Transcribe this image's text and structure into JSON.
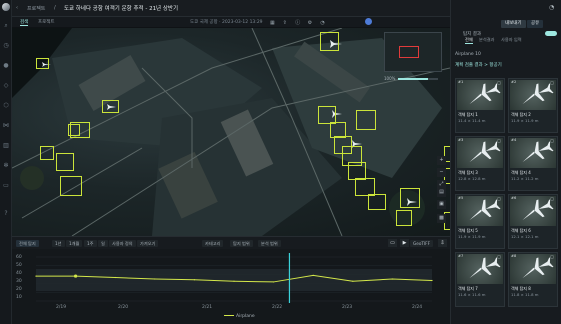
{
  "header": {
    "breadcrumb": [
      "프로젝트",
      "/"
    ],
    "title": "도쿄 하네다 공항 여객기 운항 추적 - 21년 상반기",
    "tabs": [
      "검색",
      "프로젝트"
    ],
    "active_tab": "검색",
    "meta": "도쿄 국제 공항 · 2023-03-12 13:29"
  },
  "map": {
    "opacity_label": "100%",
    "opacity_value": 0.75,
    "controls": [
      "plus-icon",
      "minus-icon",
      "expand-icon",
      "layers-icon",
      "camera-icon"
    ]
  },
  "timeline": {
    "chips": [
      "전체 탐지",
      "1년",
      "1개월",
      "1주",
      "일",
      "사용자 정의",
      "가져오기"
    ],
    "filters": [
      "카테고리",
      "탐지 범위",
      "분석 범위"
    ],
    "export": "GeoTIFF",
    "y_ticks": [
      "60",
      "50",
      "40",
      "30",
      "20",
      "10"
    ],
    "x_ticks": [
      "2/19",
      "2/20",
      "2/21",
      "2/22",
      "2/23",
      "2/24"
    ],
    "legend": "Airplane"
  },
  "chart_data": {
    "type": "line",
    "x": [
      "2/19",
      "2/19.5",
      "2/20",
      "2/20.5",
      "2/21",
      "2/21.5",
      "2/22",
      "2/22.5",
      "2/23",
      "2/23.5",
      "2/24"
    ],
    "series": [
      {
        "name": "Airplane",
        "values": [
          34,
          34,
          32,
          30,
          29,
          27,
          26,
          35,
          27,
          30,
          28
        ]
      }
    ],
    "ylim": [
      0,
      60
    ],
    "colors": {
      "line": "#d4e84a",
      "cursor": "#3bd1d9"
    }
  },
  "right_panel": {
    "buttons": {
      "export": "내보내기",
      "share": "공유"
    },
    "toggle_label": "탐지 결과",
    "segments": [
      "전체",
      "분석결과",
      "사용자 입력"
    ],
    "active_segment": "전체",
    "project_row": "Airplane 10",
    "class_row": "계획 검출 결과 > 항공기",
    "cards": [
      {
        "idx": "#1",
        "name": "객체 탐지 1",
        "size": "11.4 × 11.4 m"
      },
      {
        "idx": "#2",
        "name": "객체 탐지 2",
        "size": "11.9 × 11.9 m"
      },
      {
        "idx": "#3",
        "name": "객체 탐지 3",
        "size": "12.8 × 12.8 m"
      },
      {
        "idx": "#4",
        "name": "객체 탐지 4",
        "size": "11.2 × 11.2 m"
      },
      {
        "idx": "#5",
        "name": "객체 탐지 5",
        "size": "11.9 × 11.9 m"
      },
      {
        "idx": "#6",
        "name": "객체 탐지 6",
        "size": "12.1 × 12.1 m"
      },
      {
        "idx": "#7",
        "name": "객체 탐지 7",
        "size": "11.6 × 11.6 m"
      },
      {
        "idx": "#8",
        "name": "객체 탐지 8",
        "size": "11.8 × 11.8 m"
      }
    ]
  }
}
